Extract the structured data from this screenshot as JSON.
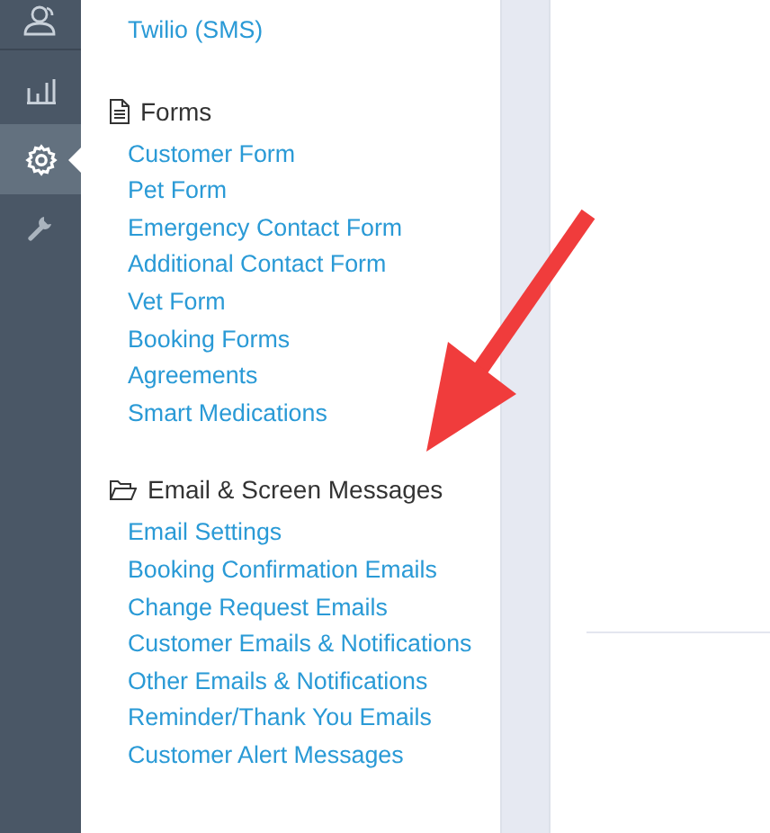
{
  "nav_rail": {
    "items": [
      {
        "kind": "users",
        "selected": false
      },
      {
        "kind": "chart",
        "selected": false
      },
      {
        "kind": "gear",
        "selected": true
      },
      {
        "kind": "wrench",
        "selected": false
      }
    ]
  },
  "menu": {
    "top_links": [
      "Twilio (SMS)"
    ],
    "sections": [
      {
        "kind": "document",
        "title": "Forms",
        "items": [
          "Customer Form",
          "Pet Form",
          "Emergency Contact Form",
          "Additional Contact Form",
          "Vet Form",
          "Booking Forms",
          "Agreements",
          "Smart Medications"
        ]
      },
      {
        "kind": "folder",
        "title": "Email & Screen Messages",
        "items": [
          "Email Settings",
          "Booking Confirmation Emails",
          "Change Request Emails",
          "Customer Emails & Notifications",
          "Other Emails & Notifications",
          "Reminder/Thank You Emails",
          "Customer Alert Messages"
        ]
      }
    ]
  }
}
